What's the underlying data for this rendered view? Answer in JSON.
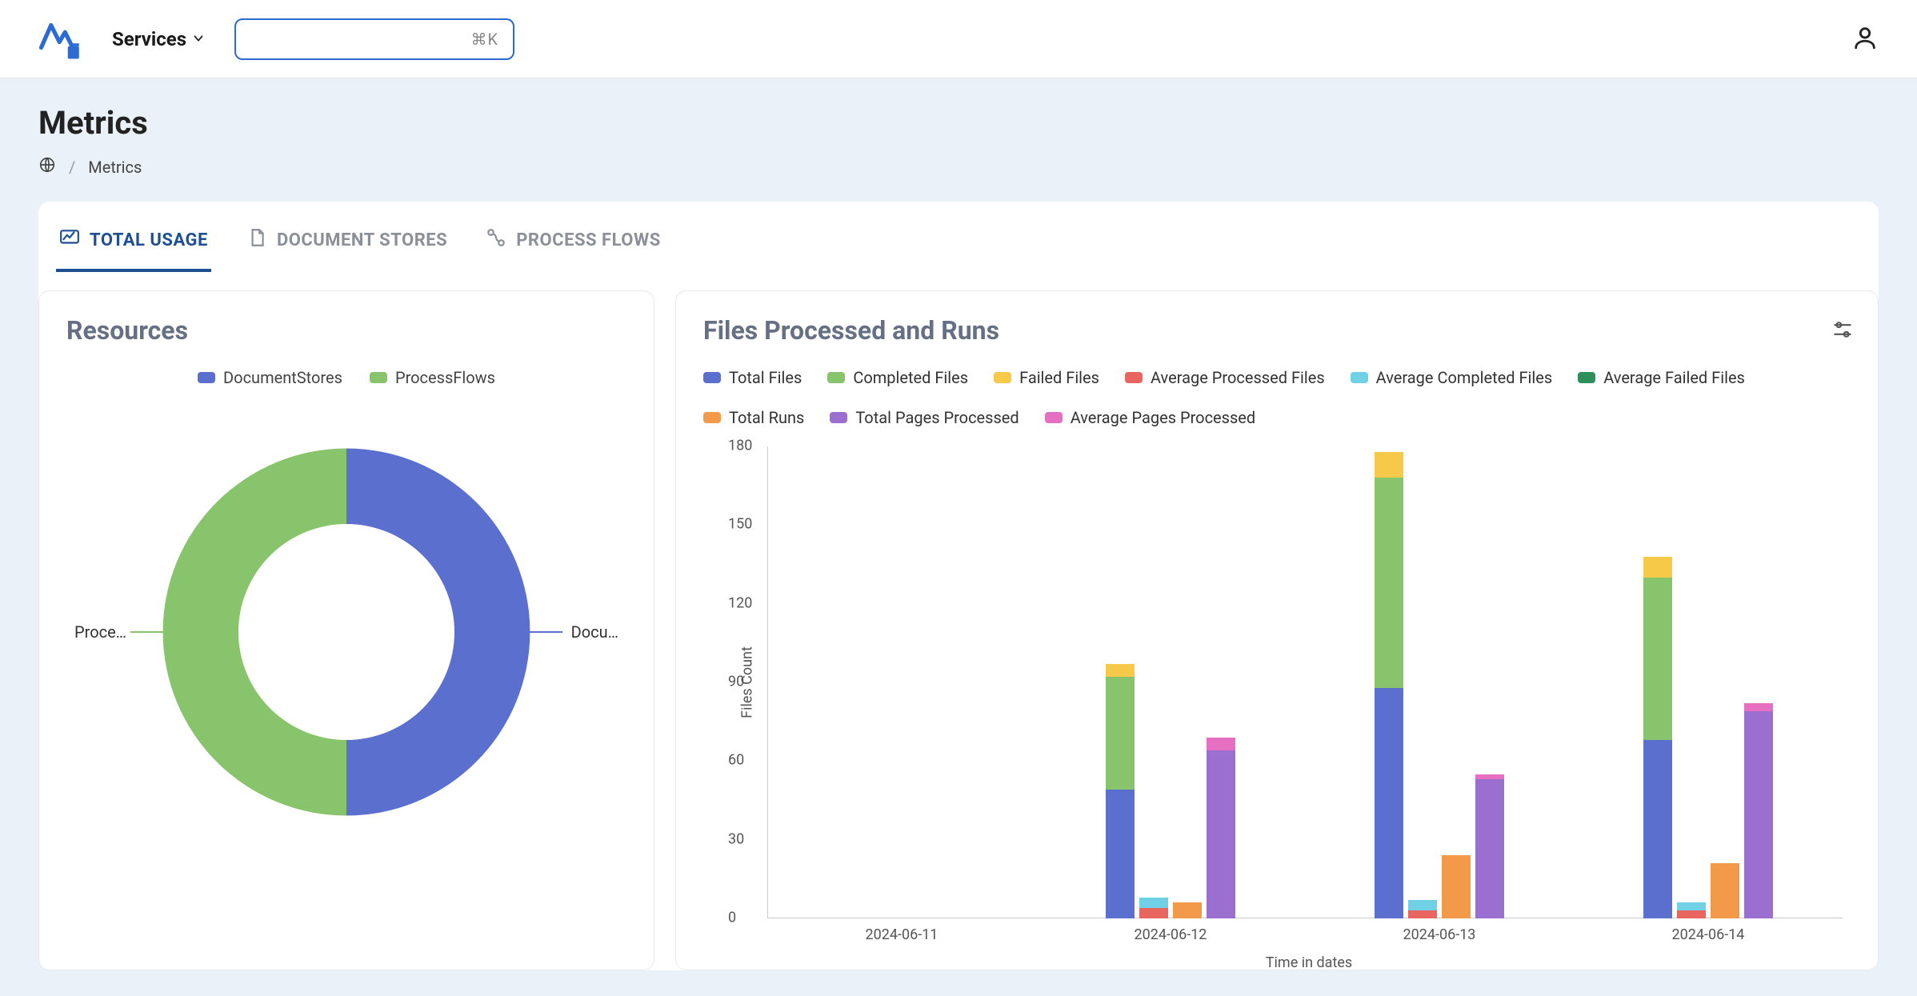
{
  "header": {
    "services_label": "Services",
    "search_shortcut": "⌘K"
  },
  "page": {
    "title": "Metrics",
    "breadcrumb_current": "Metrics"
  },
  "tabs": [
    {
      "id": "total-usage",
      "label": "TOTAL USAGE",
      "active": true
    },
    {
      "id": "document-stores",
      "label": "DOCUMENT STORES",
      "active": false
    },
    {
      "id": "process-flows",
      "label": "PROCESS FLOWS",
      "active": false
    }
  ],
  "resources": {
    "title": "Resources",
    "legend": [
      {
        "label": "DocumentStores",
        "color": "#5b6fcf"
      },
      {
        "label": "ProcessFlows",
        "color": "#88c46b"
      }
    ],
    "left_label": "Proce…",
    "right_label": "Docu…"
  },
  "files_chart": {
    "title": "Files Processed and Runs",
    "legend": [
      {
        "label": "Total Files",
        "color": "#5b6fcf"
      },
      {
        "label": "Completed Files",
        "color": "#88c46b"
      },
      {
        "label": "Failed Files",
        "color": "#f7c948"
      },
      {
        "label": "Average Processed Files",
        "color": "#e8665f"
      },
      {
        "label": "Average Completed Files",
        "color": "#6fd0e6"
      },
      {
        "label": "Average Failed Files",
        "color": "#2f8f5b"
      },
      {
        "label": "Total Runs",
        "color": "#f2994a"
      },
      {
        "label": "Total Pages Processed",
        "color": "#9a6fd0"
      },
      {
        "label": "Average Pages Processed",
        "color": "#e66fc1"
      }
    ],
    "xlabel": "Time in dates",
    "ylabel": "Files Count",
    "yticks": [
      0,
      30,
      60,
      90,
      120,
      150,
      180
    ]
  },
  "chart_data": [
    {
      "type": "pie",
      "title": "Resources",
      "series": [
        {
          "name": "DocumentStores",
          "value": 50,
          "color": "#5b6fcf"
        },
        {
          "name": "ProcessFlows",
          "value": 50,
          "color": "#88c46b"
        }
      ]
    },
    {
      "type": "bar",
      "title": "Files Processed and Runs",
      "xlabel": "Time in dates",
      "ylabel": "Files Count",
      "ylim": [
        0,
        180
      ],
      "categories": [
        "2024-06-11",
        "2024-06-12",
        "2024-06-13",
        "2024-06-14"
      ],
      "stacks": [
        {
          "name": "files",
          "segments": [
            "Total Files",
            "Completed Files",
            "Failed Files"
          ],
          "colors": [
            "#5b6fcf",
            "#88c46b",
            "#f7c948"
          ],
          "values": [
            [
              0,
              0,
              0
            ],
            [
              49,
              43,
              5
            ],
            [
              88,
              80,
              10
            ],
            [
              68,
              62,
              8
            ]
          ]
        },
        {
          "name": "avg_files",
          "segments": [
            "Average Processed Files",
            "Average Completed Files",
            "Average Failed Files"
          ],
          "colors": [
            "#e8665f",
            "#6fd0e6",
            "#2f8f5b"
          ],
          "values": [
            [
              0,
              0,
              0
            ],
            [
              4,
              4,
              0
            ],
            [
              3,
              4,
              0
            ],
            [
              3,
              3,
              0
            ]
          ]
        },
        {
          "name": "runs",
          "segments": [
            "Total Runs"
          ],
          "colors": [
            "#f2994a"
          ],
          "values": [
            [
              0
            ],
            [
              6
            ],
            [
              24
            ],
            [
              21
            ]
          ]
        },
        {
          "name": "pages",
          "segments": [
            "Total Pages Processed",
            "Average Pages Processed"
          ],
          "colors": [
            "#9a6fd0",
            "#e66fc1"
          ],
          "values": [
            [
              0,
              0
            ],
            [
              64,
              5
            ],
            [
              53,
              2
            ],
            [
              79,
              3
            ]
          ]
        }
      ]
    }
  ]
}
